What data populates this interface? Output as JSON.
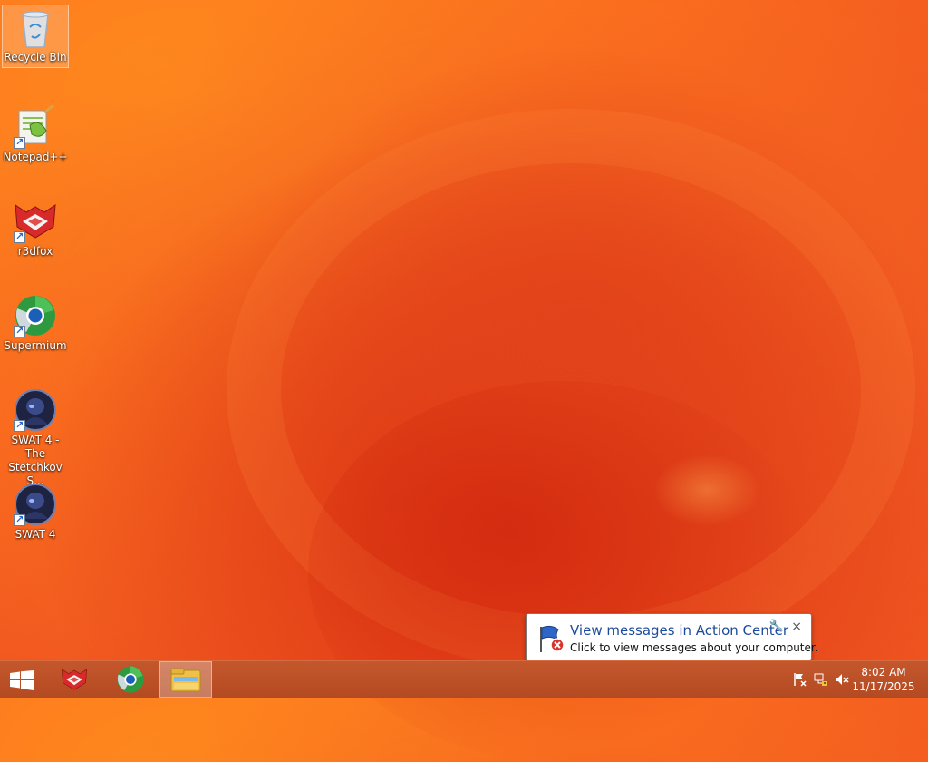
{
  "desktop": {
    "icons": [
      {
        "label": "Recycle Bin",
        "icon": "recycle-bin-icon"
      },
      {
        "label": "Notepad++",
        "icon": "notepad-plus-plus-icon"
      },
      {
        "label": "r3dfox",
        "icon": "r3dfox-icon"
      },
      {
        "label": "Supermium",
        "icon": "supermium-icon"
      },
      {
        "label": "SWAT 4 - The Stetchkov S...",
        "icon": "swat4-expansion-icon"
      },
      {
        "label": "SWAT 4",
        "icon": "swat4-icon"
      }
    ]
  },
  "notification": {
    "title": "View messages in Action Center",
    "text": "Click to view messages about your computer.",
    "close_label": "×",
    "icon": "action-center-flag-icon"
  },
  "taskbar": {
    "start_icon": "windows-start-icon",
    "pinned": [
      {
        "name": "r3dfox",
        "icon": "r3dfox-icon"
      },
      {
        "name": "Supermium",
        "icon": "supermium-icon"
      },
      {
        "name": "File Explorer",
        "icon": "file-explorer-icon",
        "active": true
      }
    ],
    "tray": [
      "action-center-flag-icon",
      "network-icon",
      "volume-muted-icon"
    ],
    "clock": {
      "time": "8:02 AM",
      "date": "11/17/2025"
    }
  },
  "colors": {
    "wallpaper_main": "#f25a21",
    "taskbar": "#bd5027",
    "notification_title": "#1c4a9c"
  }
}
